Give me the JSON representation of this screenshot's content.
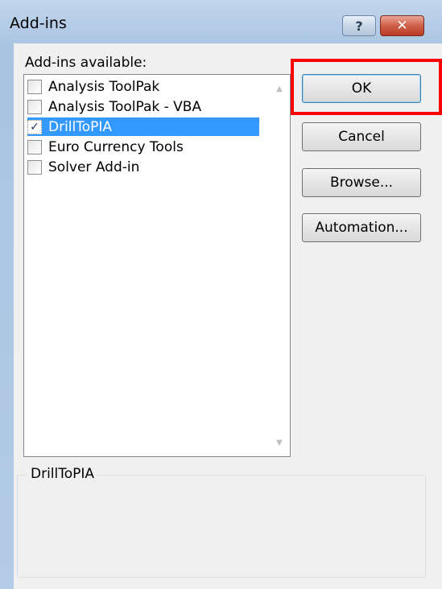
{
  "window": {
    "title": "Add-ins",
    "help_glyph": "?",
    "close_glyph": "✕"
  },
  "list": {
    "label": "Add-ins available:",
    "items": [
      {
        "label": "Analysis ToolPak",
        "checked": false,
        "selected": false
      },
      {
        "label": "Analysis ToolPak - VBA",
        "checked": false,
        "selected": false
      },
      {
        "label": "DrillToPIA",
        "checked": true,
        "selected": true
      },
      {
        "label": "Euro Currency Tools",
        "checked": false,
        "selected": false
      },
      {
        "label": "Solver Add-in",
        "checked": false,
        "selected": false
      }
    ],
    "check_glyph": "✓"
  },
  "buttons": {
    "ok": "OK",
    "cancel": "Cancel",
    "browse": "Browse...",
    "automation": "Automation..."
  },
  "description": {
    "title": "DrillToPIA"
  },
  "colors": {
    "selection": "#3399ff",
    "highlight_box": "#ff0000",
    "close_button": "#c9432b"
  },
  "icons": {
    "help": "help-icon",
    "close": "close-icon",
    "scroll_up": "chevron-up-icon",
    "scroll_down": "chevron-down-icon"
  }
}
